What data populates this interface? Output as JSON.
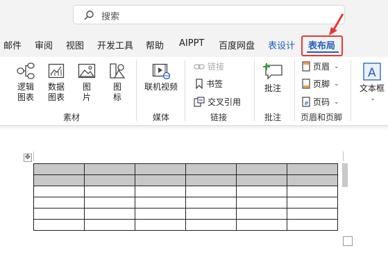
{
  "search": {
    "placeholder": "搜索"
  },
  "tabs": [
    {
      "label": "邮件"
    },
    {
      "label": "审阅"
    },
    {
      "label": "视图"
    },
    {
      "label": "开发工具"
    },
    {
      "label": "帮助"
    },
    {
      "label": "AIPPT"
    },
    {
      "label": "百度网盘"
    },
    {
      "label": "表设计"
    },
    {
      "label": "表布局"
    }
  ],
  "ribbon": {
    "sucai": {
      "group_label": "素材",
      "logic_chart": [
        "逻辑",
        "图表"
      ],
      "data_chart": [
        "数据",
        "图表"
      ],
      "picture": [
        "图",
        "片"
      ],
      "icon": [
        "图",
        "标"
      ]
    },
    "media": {
      "group_label": "媒体",
      "online_video": "联机视频"
    },
    "links": {
      "group_label": "链接",
      "link": "链接",
      "bookmark": "书签",
      "cross_ref": "交叉引用"
    },
    "comments": {
      "group_label": "批注",
      "comment": "批注"
    },
    "header_footer": {
      "group_label": "页眉和页脚",
      "header": "页眉",
      "footer": "页脚",
      "page_number": "页码"
    },
    "text": {
      "textbox": "文本框"
    }
  },
  "colors": {
    "accent": "#1f5fbf",
    "highlight": "#e53935",
    "selection": "#c8c8c8"
  },
  "table": {
    "rows": 6,
    "cols": 6,
    "selected_rows": 2
  }
}
